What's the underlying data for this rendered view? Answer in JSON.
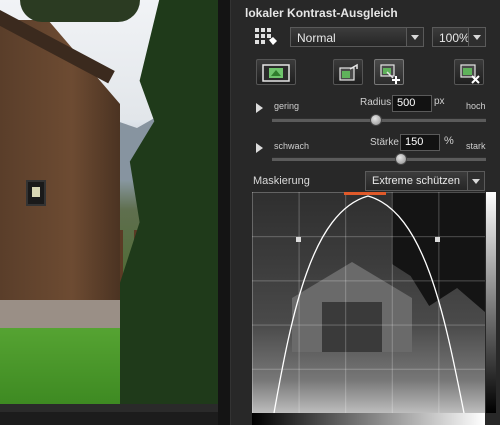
{
  "panel": {
    "title": "lokaler Kontrast-Ausgleich",
    "blend_mode": "Normal",
    "opacity": "100%"
  },
  "radius": {
    "left_label": "gering",
    "name": "Radius",
    "value": "500",
    "unit": "px",
    "right_label": "hoch",
    "level": 0.48
  },
  "strength": {
    "left_label": "schwach",
    "name": "Stärke",
    "value": "150",
    "unit": "%",
    "right_label": "stark",
    "level": 0.6
  },
  "mask": {
    "label": "Maskierung",
    "preset": "Extreme schützen"
  },
  "icons": {
    "grid": "grid-icon",
    "tool1": "mask-frame-icon",
    "tool2": "export-icon",
    "tool3": "add-layer-icon",
    "tool4": "delete-layer-icon"
  },
  "colors": {
    "accent": "#e05a2a",
    "panel_bg": "#282828"
  }
}
